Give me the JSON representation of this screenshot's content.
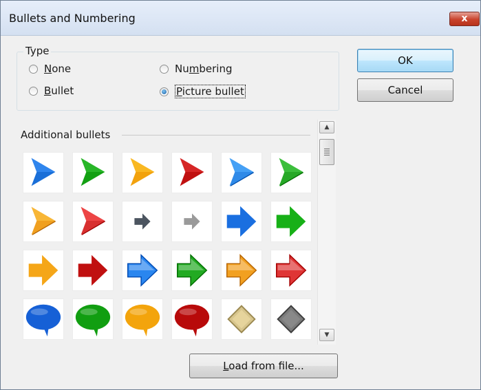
{
  "dialog": {
    "title": "Bullets and Numbering",
    "close_label": "x"
  },
  "type_group": {
    "label": "Type",
    "options": [
      {
        "label": "None",
        "mnemonic": "N",
        "rest": "one",
        "checked": false
      },
      {
        "label": "Bullet",
        "mnemonic": "B",
        "rest": "ullet",
        "checked": false
      },
      {
        "label": "Numbering",
        "mnemonic_prefix": "Nu",
        "mnemonic": "m",
        "rest": "bering",
        "checked": false
      },
      {
        "label": "Picture bullet",
        "mnemonic": "P",
        "rest": "icture bullet",
        "checked": true
      }
    ]
  },
  "buttons": {
    "ok": "OK",
    "cancel": "Cancel",
    "load_prefix": "",
    "load_mnemonic": "L",
    "load_rest": "oad from file..."
  },
  "additional_bullets": {
    "label": "Additional bullets",
    "items": [
      {
        "icon": "blue-chevron-arrow-icon",
        "color": "#1a6fd8"
      },
      {
        "icon": "green-chevron-arrow-icon",
        "color": "#13a013"
      },
      {
        "icon": "orange-chevron-arrow-icon",
        "color": "#f2a20d"
      },
      {
        "icon": "red-chevron-arrow-icon",
        "color": "#c01010"
      },
      {
        "icon": "blue-glossy-chevron-icon",
        "color": "#2f8ae8"
      },
      {
        "icon": "green-glossy-chevron-icon",
        "color": "#27a827"
      },
      {
        "icon": "orange-glossy-chevron-icon",
        "color": "#f0a020"
      },
      {
        "icon": "red-glossy-chevron-icon",
        "color": "#d83030"
      },
      {
        "icon": "dark-gray-small-arrow-icon",
        "color": "#4c5560"
      },
      {
        "icon": "gray-small-arrow-icon",
        "color": "#9a9a9a"
      },
      {
        "icon": "blue-block-arrow-icon",
        "color": "#1a6fe0"
      },
      {
        "icon": "green-block-arrow-icon",
        "color": "#17b017"
      },
      {
        "icon": "orange-block-arrow-icon",
        "color": "#f5a618"
      },
      {
        "icon": "red-block-arrow-icon",
        "color": "#c01010"
      },
      {
        "icon": "blue-glossy-block-arrow-icon",
        "color": "#2a86ef"
      },
      {
        "icon": "green-glossy-block-arrow-icon",
        "color": "#22aa22"
      },
      {
        "icon": "orange-glossy-block-arrow-icon",
        "color": "#f2a020"
      },
      {
        "icon": "red-glossy-block-arrow-icon",
        "color": "#df3535"
      },
      {
        "icon": "blue-speech-bubble-icon",
        "color": "#1660d6"
      },
      {
        "icon": "green-speech-bubble-icon",
        "color": "#119e11"
      },
      {
        "icon": "orange-speech-bubble-icon",
        "color": "#f3a40c"
      },
      {
        "icon": "red-speech-bubble-icon",
        "color": "#b80a0a"
      },
      {
        "icon": "tan-diamond-icon",
        "color": "#d7c58d"
      },
      {
        "icon": "gray-diamond-icon",
        "color": "#7a7a7a"
      }
    ]
  }
}
